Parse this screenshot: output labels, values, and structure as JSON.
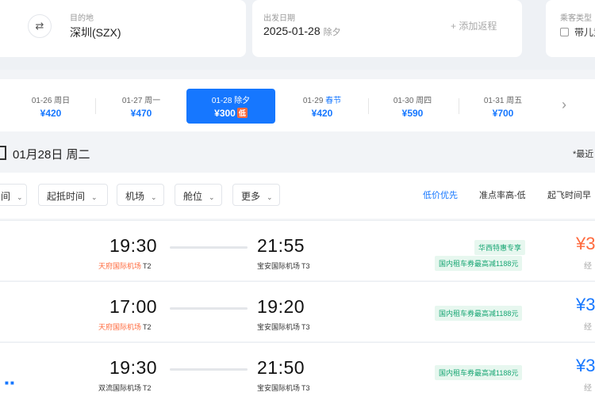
{
  "search": {
    "dest_label": "目的地",
    "dest_value": "深圳(SZX)",
    "date_label": "出发日期",
    "date_value": "2025-01-28",
    "date_weekday": "除夕",
    "add_return": "+ 添加返程",
    "passenger_label": "乘客类型",
    "child_option": "带儿童"
  },
  "date_strip": [
    {
      "date": "01-26",
      "day": "周日",
      "price": "¥420"
    },
    {
      "date": "01-27",
      "day": "周一",
      "price": "¥470"
    },
    {
      "date": "01-28",
      "day": "除夕",
      "price": "¥300",
      "badge": "低",
      "selected": true
    },
    {
      "date": "01-29",
      "day": "春节",
      "price": "¥420"
    },
    {
      "date": "01-30",
      "day": "周四",
      "price": "¥590"
    },
    {
      "date": "01-31",
      "day": "周五",
      "price": "¥700"
    }
  ],
  "day_header": {
    "title": "01月28日 周二",
    "right_text": "*最近"
  },
  "filters": [
    {
      "label": "间"
    },
    {
      "label": "起抵时间"
    },
    {
      "label": "机场"
    },
    {
      "label": "舱位"
    },
    {
      "label": "更多"
    }
  ],
  "sort_options": [
    {
      "label": "低价优先",
      "active": true
    },
    {
      "label": "准点率高-低"
    },
    {
      "label": "起飞时间早"
    }
  ],
  "flights": [
    {
      "dep_time": "19:30",
      "dep_airport": "天府国际机场",
      "dep_terminal": "T2",
      "arr_time": "21:55",
      "arr_airport": "宝安国际机场",
      "arr_terminal": "T3",
      "tags": [
        "华西特惠专享",
        "国内租车券最高减1188元"
      ],
      "price": "¥3",
      "price_sub": "经"
    },
    {
      "dep_time": "17:00",
      "dep_airport": "天府国际机场",
      "dep_terminal": "T2",
      "arr_time": "19:20",
      "arr_airport": "宝安国际机场",
      "arr_terminal": "T3",
      "tags": [
        "国内租车券最高减1188元"
      ],
      "price": "¥3",
      "price_sub": "经"
    },
    {
      "dep_time": "19:30",
      "dep_airport": "双流国际机场",
      "dep_terminal": "T2",
      "arr_time": "21:50",
      "arr_airport": "宝安国际机场",
      "arr_terminal": "T3",
      "tags": [
        "国内租车券最高减1188元"
      ],
      "price": "¥3",
      "price_sub": "经"
    }
  ],
  "colors": {
    "accent": "#1677ff",
    "orange": "#ff6a3d",
    "green": "#17a673"
  },
  "icons": {
    "swap": "swap-icon",
    "next": "chevron-right-icon",
    "calendar": "calendar-icon"
  }
}
